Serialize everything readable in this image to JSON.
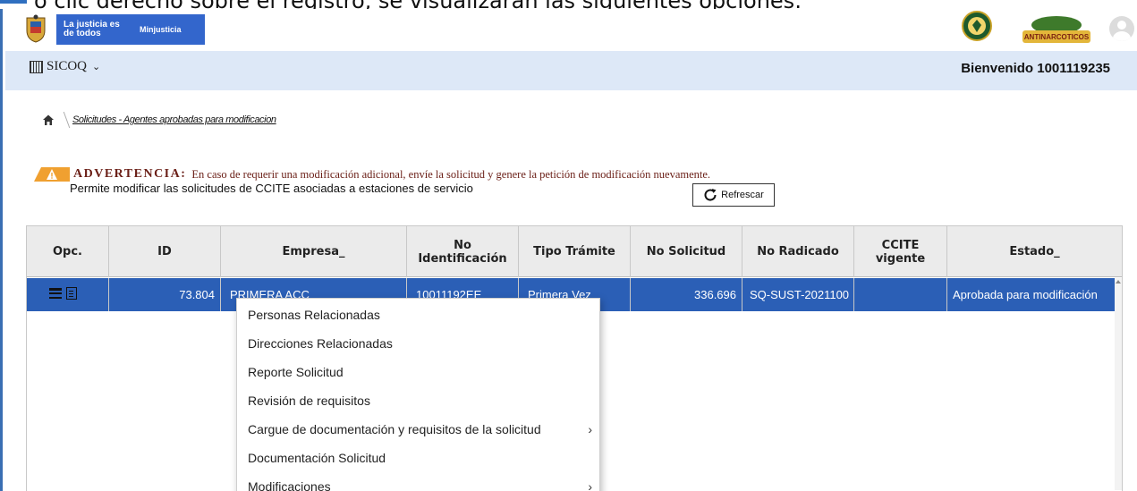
{
  "document": {
    "line": "o clic derecho sobre el registro, se visualizarán las siguientes opciones:"
  },
  "header": {
    "gov_text": "La justicia es de todos",
    "gov_ministry": "Minjusticia",
    "anti_logo_text": "ANTINARCOTICOS",
    "app_name": "SICOQ",
    "welcome": "Bienvenido 1001119235"
  },
  "breadcrumb": {
    "page": "Solicitudes - Agentes aprobadas para modificacion"
  },
  "notice": {
    "label": "ADVERTENCIA:",
    "message": "En caso de requerir una modificación adicional, envíe la solicitud y genere la petición de modificación nuevamente.",
    "description": "Permite modificar las solicitudes de CCITE asociadas a estaciones de servicio",
    "refresh_label": "Refrescar"
  },
  "table": {
    "columns": [
      "Opc.",
      "ID",
      "Empresa_",
      "No Identificación",
      "Tipo Trámite",
      "No Solicitud",
      "No Radicado",
      "CCITE vigente",
      "Estado_"
    ],
    "rows": [
      {
        "id": "73.804",
        "empresa": "PRIMERA ACC",
        "identificacion": "10011192EE",
        "tipo_tramite": "Primera Vez",
        "no_solicitud": "336.696",
        "no_radicado": "SQ-SUST-2021100",
        "ccite_vigente": "",
        "estado": "Aprobada para modificación"
      }
    ]
  },
  "context_menu": {
    "items": [
      {
        "label": "Personas Relacionadas",
        "submenu": ""
      },
      {
        "label": "Direcciones Relacionadas",
        "submenu": ""
      },
      {
        "label": "Reporte Solicitud",
        "submenu": ""
      },
      {
        "label": "Revisión de requisitos",
        "submenu": ""
      },
      {
        "label": "Cargue de documentación y requisitos de la solicitud",
        "submenu": "›"
      },
      {
        "label": "Documentación Solicitud",
        "submenu": ""
      },
      {
        "label": "Modificaciones",
        "submenu": "›"
      }
    ]
  },
  "colors": {
    "selected_row": "#2b5fb6",
    "subbar": "#dde8f7",
    "gov_blue": "#3366cc",
    "warning_text": "#6a1e16"
  }
}
